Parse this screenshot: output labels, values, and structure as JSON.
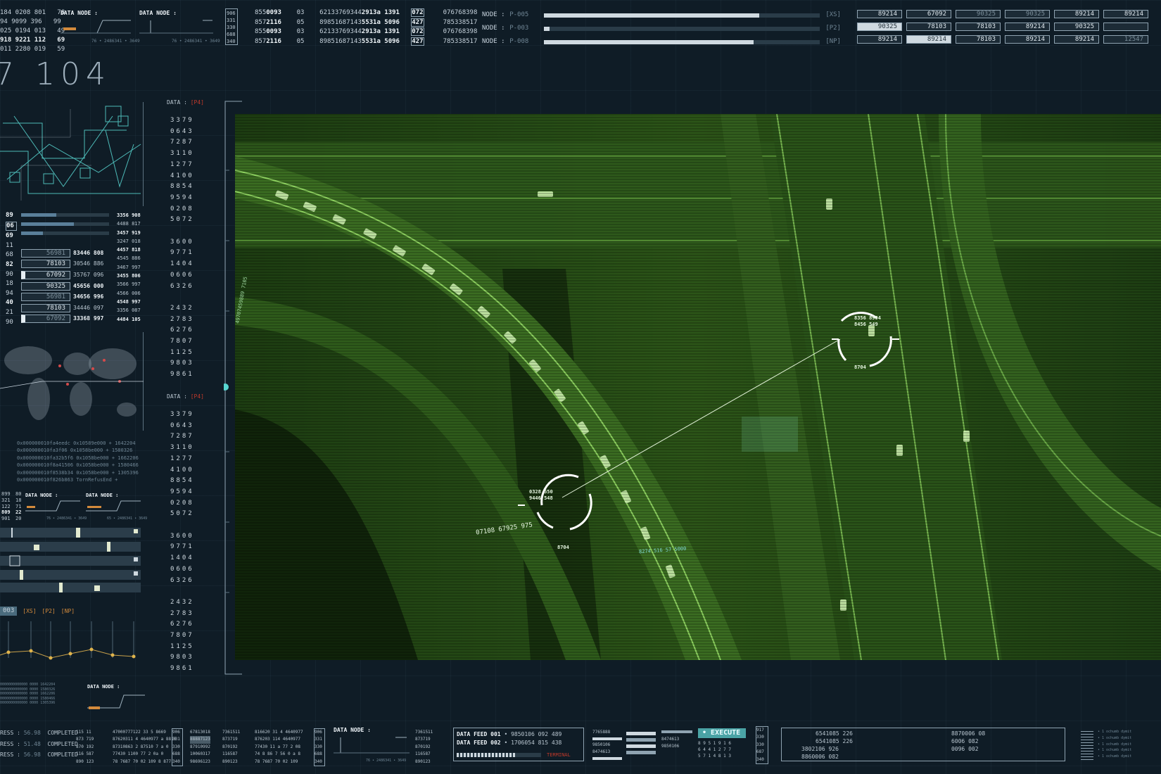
{
  "header": {
    "left_rows": [
      {
        "a": "184 0208 801",
        "b": "78"
      },
      {
        "a": "94 9099 396",
        "b": "99"
      },
      {
        "a": "025 0194 013",
        "b": "49"
      },
      {
        "a": "918 9221 112",
        "b": "69"
      },
      {
        "a": "011 2280 019",
        "b": "59"
      }
    ],
    "node_label_1": "DATA NODE :",
    "node_label_2": "DATA NODE :",
    "node_value_1": "76 • 2486341 • 3649",
    "node_value_2": "76 • 2486341 • 3649",
    "node_col": [
      "906",
      "331",
      "330",
      "688",
      "340"
    ],
    "data_rows": [
      {
        "a": "855",
        "b": "0093",
        "c": "03",
        "d": "62133769344",
        "e": "2913a",
        "f": "1391",
        "box": "072",
        "g": "076768398"
      },
      {
        "a": "857",
        "b": "2116",
        "c": "05",
        "d": "89851687143",
        "e": "5531a",
        "f": "5096",
        "box": "427",
        "g": "785338517"
      },
      {
        "a": "855",
        "b": "0093",
        "c": "03",
        "d": "62133769344",
        "e": "2913a",
        "f": "1391",
        "box": "072",
        "g": "076768398"
      },
      {
        "a": "857",
        "b": "2116",
        "c": "05",
        "d": "89851687143",
        "e": "5531a",
        "f": "5096",
        "box": "427",
        "g": "785338517"
      }
    ],
    "nodes": [
      {
        "label": "NODE :",
        "id": "P-005",
        "tag": "[XS]",
        "fill": 0.78
      },
      {
        "label": "NODE :",
        "id": "P-003",
        "tag": "[P2]",
        "fill": 0.02
      },
      {
        "label": "NODE :",
        "id": "P-008",
        "tag": "[NP]",
        "fill": 0.76
      }
    ],
    "badges": [
      [
        "89214",
        "67092",
        "90325",
        "90325",
        "89214",
        "89214"
      ],
      [
        "90325",
        "78103",
        "78103",
        "89214",
        "90325",
        ""
      ],
      [
        "89214",
        "89214",
        "78103",
        "89214",
        "89214",
        "12547"
      ]
    ]
  },
  "left_panel": {
    "big_number": "7 104",
    "list_left": [
      "89",
      "06",
      "69",
      "11",
      "68",
      "82",
      "90",
      "18",
      "94",
      "40",
      "21",
      "90"
    ],
    "list_badges": [
      "56981",
      "78103",
      "67092",
      "90325",
      "56981",
      "78103",
      "67092"
    ],
    "list_mid": [
      "83446 808",
      "30546 886",
      "35767 096",
      "45656 000",
      "34656 996",
      "34446 097",
      "33368 997"
    ],
    "list_right": [
      "3356 908",
      "4488 817",
      "3457 919",
      "3247 018",
      "4457 818",
      "4545 886",
      "3467 997",
      "3455 806",
      "3566 997",
      "4566 006",
      "4548 997",
      "3356 087",
      "4484 105"
    ],
    "hex_lines": [
      "0x000000010fa4eedc 0x10589e000 + 1642204",
      "0x000000010fa3f06 0x1058be000 + 1580326",
      "0x000000010fa32b5f6 0x1058be000 + 1662206",
      "0x000000010f8a41506 0x1058be000 + 1580466",
      "0x000000010f8538b34 0x1058be000 + 1305396",
      "0x000000010f826b863 TornRefusEnd +"
    ],
    "mini_nodes": [
      "DATA NODE :",
      "DATA NODE :"
    ],
    "mini_vals": [
      "76 • 2486341 • 3649",
      "65 • 2486341 • 3649"
    ],
    "mini_left": [
      "899",
      "321",
      "122",
      "809",
      "901"
    ],
    "mini_left2": [
      "80",
      "18",
      "71",
      "22",
      "20"
    ],
    "graph_title": "003",
    "graph_tags": [
      "[XS]",
      "[P2]",
      "[NP]"
    ],
    "bottom_node": "DATA NODE :",
    "bottom_lines": [
      "0000000000000 0000 1642204",
      "0000000000000 0000 1580326",
      "0000000000000 0000 1662206",
      "0000000000000 0000 1580466",
      "0000000000000 0000 1305396"
    ]
  },
  "data_column": {
    "label1": "DATA :",
    "tag1": "[P4]",
    "label2": "DATA :",
    "tag2": "[P4]",
    "nums": [
      "3379",
      "0643",
      "7287",
      "3110",
      "1277",
      "4100",
      "8854",
      "9594",
      "0208",
      "5072",
      "",
      "3600",
      "9771",
      "1404",
      "0606",
      "6326",
      "",
      "2432",
      "2783",
      "6276",
      "7807",
      "1125",
      "9803",
      "9861"
    ]
  },
  "viewport": {
    "target1": {
      "l1": "0328 550",
      "l2": "9446 548",
      "id": "8704",
      "side": "07108 67925 975"
    },
    "target2": {
      "l1": "8356 8904",
      "l2": "8456 549",
      "id": "8704"
    },
    "side_text": "49707459889 7105",
    "coord_text": "8274 516 57 5000"
  },
  "footer": {
    "progress": [
      {
        "label": "RESS :",
        "pct": "56.98",
        "status": "COMPLETED"
      },
      {
        "label": "RESS :",
        "pct": "51.48",
        "status": "COMPLETED"
      },
      {
        "label": "RESS :",
        "pct": "56.98",
        "status": "COMPLETED"
      }
    ],
    "colA": [
      "115 11",
      "873 719",
      "870 192",
      "116 587",
      "890 123"
    ],
    "colB": [
      "47000777122 33 5 8669",
      "87620311 4 4640977 a 8810",
      "87310863 2 87510 7 a 0",
      "77430 1100 77 2 0a 0",
      "78 7687 70 02 109 8 877"
    ],
    "colC": [
      "906",
      "331",
      "330",
      "688",
      "340"
    ],
    "colD": [
      "67813018",
      "88887123",
      "87910992",
      "10060317",
      "98696123"
    ],
    "colE": [
      "7361511",
      "873719",
      "870192",
      "116587",
      "890123"
    ],
    "colF": [
      "816620 31 4 4640977",
      "876203 114 4640977",
      "77430 11 a 77 2 08",
      "74 8 86 7 56 0 a 8",
      "78 7687 70 02 109"
    ],
    "node": "DATA NODE :",
    "node_val": "76 • 2486341 • 3649",
    "colG": [
      "7361511",
      "873719",
      "870192",
      "116587",
      "890123"
    ],
    "feed1_label": "DATA FEED 001",
    "feed1_val": "• 9850106 092 489",
    "feed2_label": "DATA FEED 002",
    "feed2_val": "• 1706054 815 438",
    "terminal": "TERMINAL",
    "stack": [
      "7765888",
      "8474613",
      "9850106",
      "8474613",
      "9850106"
    ],
    "execute": "EXECUTE",
    "exec_lines": [
      "8 9 5 1 9 1 6",
      "6 4 4 1 2 7 7",
      "5 7 1 4 8 1 3"
    ],
    "exec_col": [
      "917",
      "330",
      "330",
      "687",
      "340"
    ],
    "right_rows": [
      {
        "a": "6541085 226",
        "b": "8870006 08"
      },
      {
        "a": "6541085 226",
        "b": "6006 082"
      },
      {
        "a": "3802106 926",
        "b": "0096 002"
      },
      {
        "a": "8860006 082",
        "b": ""
      }
    ],
    "legend": [
      "• 1 ochumb dymit",
      "• 1 ochumb dymit",
      "• 1 ochumb dymit",
      "• 1 ochumb dymit",
      "• 1 ochumb dymit"
    ]
  }
}
